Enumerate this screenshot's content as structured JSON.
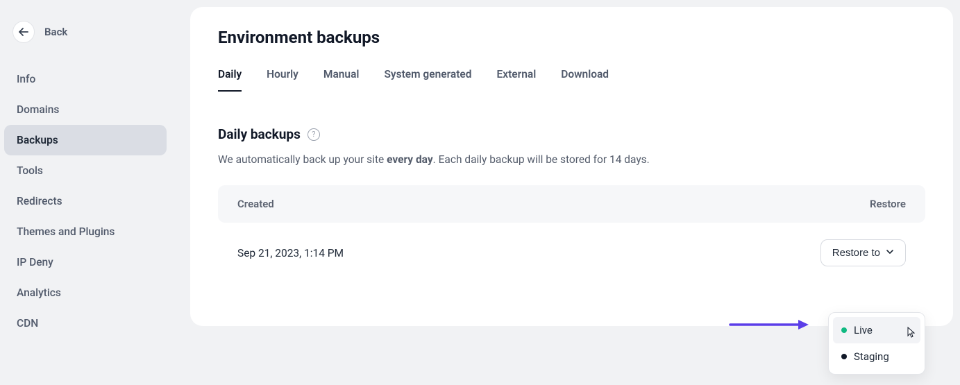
{
  "sidebar": {
    "back_label": "Back",
    "items": [
      {
        "label": "Info",
        "active": false
      },
      {
        "label": "Domains",
        "active": false
      },
      {
        "label": "Backups",
        "active": true
      },
      {
        "label": "Tools",
        "active": false
      },
      {
        "label": "Redirects",
        "active": false
      },
      {
        "label": "Themes and Plugins",
        "active": false
      },
      {
        "label": "IP Deny",
        "active": false
      },
      {
        "label": "Analytics",
        "active": false
      },
      {
        "label": "CDN",
        "active": false
      }
    ]
  },
  "main": {
    "title": "Environment backups",
    "tabs": [
      {
        "label": "Daily",
        "active": true
      },
      {
        "label": "Hourly",
        "active": false
      },
      {
        "label": "Manual",
        "active": false
      },
      {
        "label": "System generated",
        "active": false
      },
      {
        "label": "External",
        "active": false
      },
      {
        "label": "Download",
        "active": false
      }
    ],
    "section_title": "Daily backups",
    "desc_prefix": "We automatically back up your site ",
    "desc_bold": "every day",
    "desc_suffix": ". Each daily backup will be stored for 14 days.",
    "table": {
      "col_created": "Created",
      "col_restore": "Restore",
      "rows": [
        {
          "created": "Sep 21, 2023, 1:14 PM",
          "restore_label": "Restore to"
        }
      ]
    },
    "dropdown": {
      "items": [
        {
          "label": "Live",
          "dot": "green",
          "hovered": true
        },
        {
          "label": "Staging",
          "dot": "black",
          "hovered": false
        }
      ]
    }
  }
}
